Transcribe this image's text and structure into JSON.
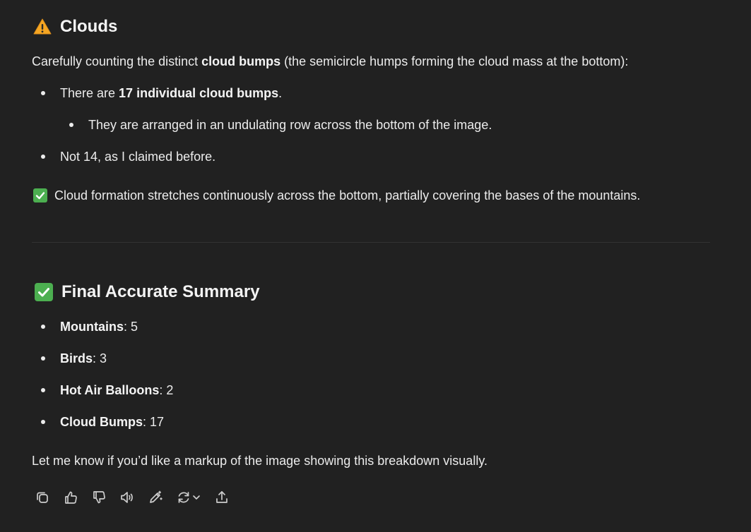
{
  "clouds_section": {
    "heading_icon": "warning-icon",
    "heading": "Clouds",
    "intro_prefix": "Carefully counting the distinct ",
    "intro_bold": "cloud bumps",
    "intro_suffix": " (the semicircle humps forming the cloud mass at the bottom):",
    "bullet1_prefix": "There are ",
    "bullet1_bold": "17 individual cloud bumps",
    "bullet1_suffix": ".",
    "sub_bullet": "They are arranged in an undulating row across the bottom of the image.",
    "bullet2": "Not 14, as I claimed before.",
    "check_icon": "check-box-icon",
    "check_text": "Cloud formation stretches continuously across the bottom, partially covering the bases of the mountains."
  },
  "summary_section": {
    "heading_icon": "check-box-icon",
    "heading": "Final Accurate Summary",
    "items": [
      {
        "label": "Mountains",
        "sep": ": ",
        "value": "5"
      },
      {
        "label": "Birds",
        "sep": ": ",
        "value": "3"
      },
      {
        "label": "Hot Air Balloons",
        "sep": ": ",
        "value": "2"
      },
      {
        "label": "Cloud Bumps",
        "sep": ": ",
        "value": "17"
      }
    ],
    "closing": "Let me know if you’d like a markup of the image showing this breakdown visually."
  },
  "action_bar": {
    "icons": [
      "copy-icon",
      "thumbs-up-icon",
      "thumbs-down-icon",
      "read-aloud-icon",
      "edit-icon",
      "regenerate-icon",
      "share-icon"
    ]
  },
  "colors": {
    "background": "#212121",
    "text": "#ececec",
    "warning": "#f5a623",
    "check": "#4caf50"
  }
}
